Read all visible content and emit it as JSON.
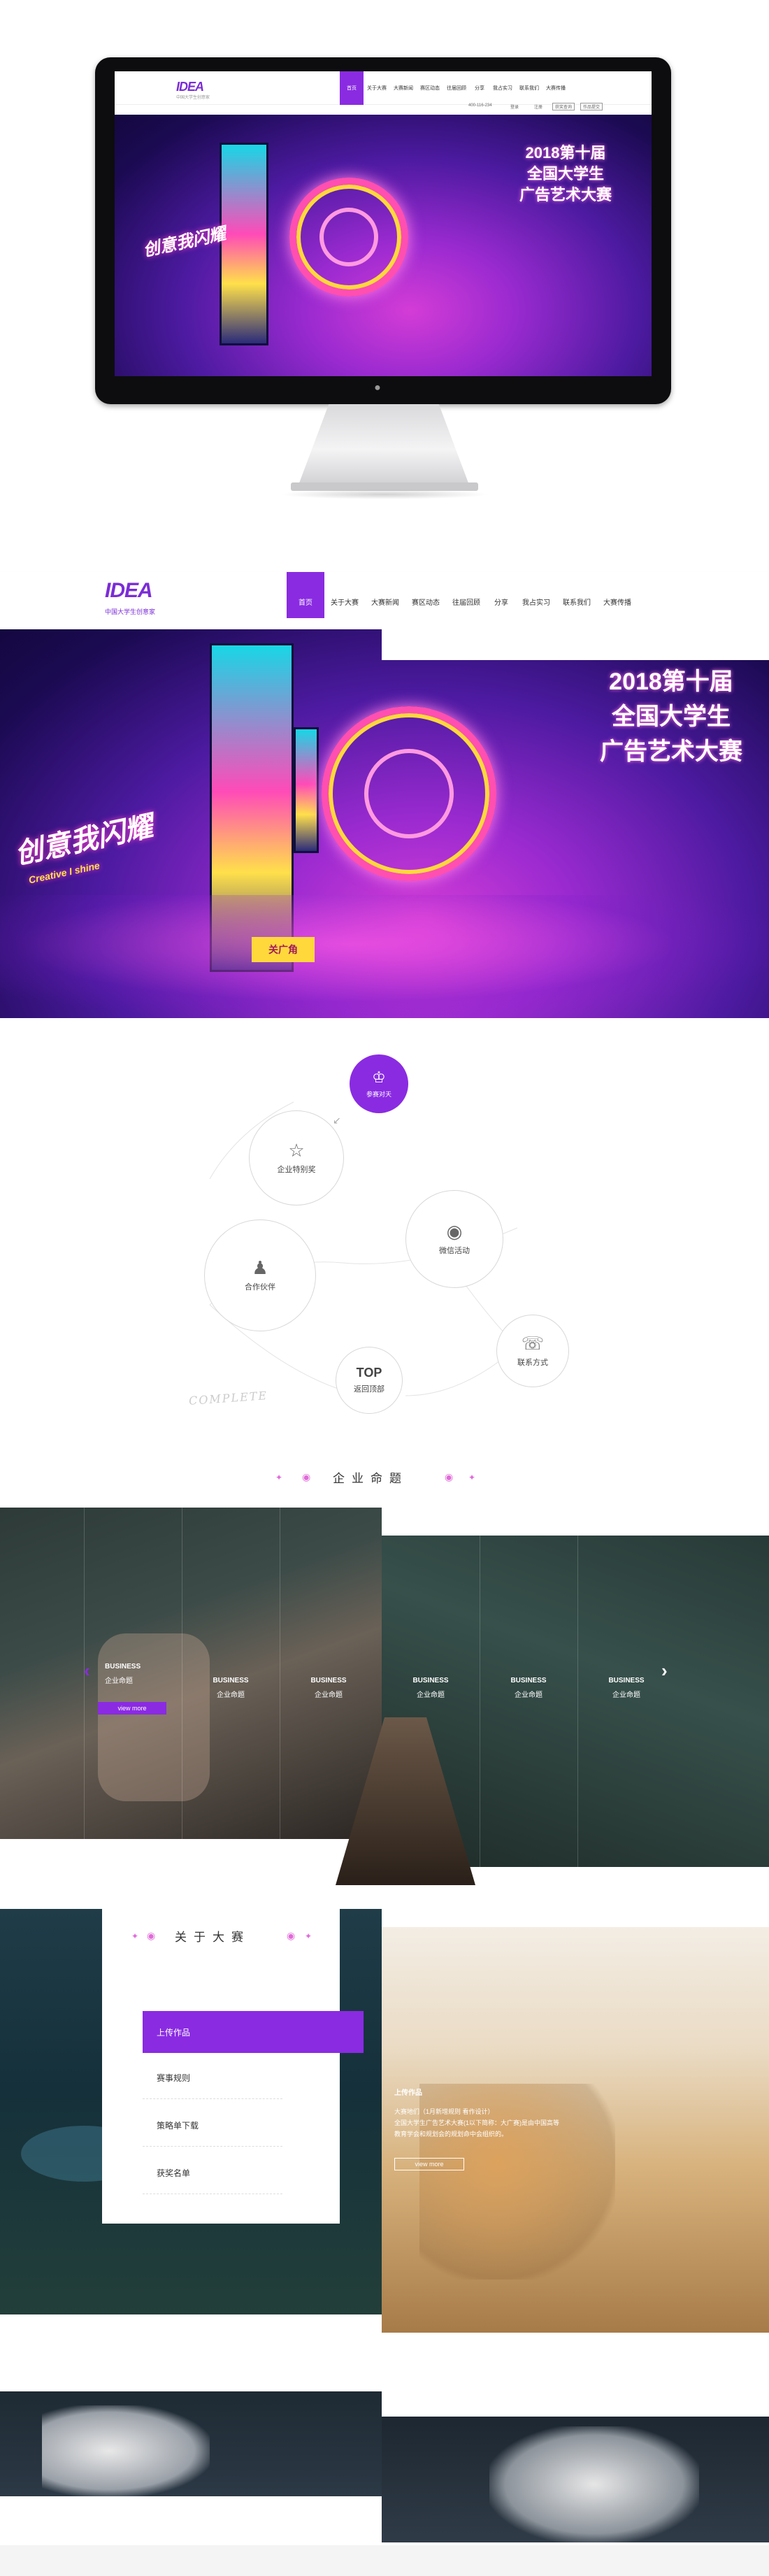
{
  "brand": {
    "logo": "IDEA",
    "tagline": "中国大学生创意家",
    "accent": "#8a2be2"
  },
  "nav": {
    "items": [
      "首页",
      "关于大赛",
      "大赛新闻",
      "赛区动态",
      "往届回顾",
      "分享",
      "我占实习",
      "联系我们",
      "大赛传播"
    ],
    "active_index": 0,
    "phone": "400-116-234",
    "login": "登录",
    "register": "注册",
    "query_btn": "获奖查询",
    "submit_btn": "作品提交"
  },
  "banner": {
    "line1": "2018第十届",
    "line2": "全国大学生",
    "line3": "广告艺术大赛",
    "slogan": "创意我闪耀",
    "slogan_en": "Creative I shine",
    "sign": "关广角"
  },
  "orbit": {
    "center": "参赛对天",
    "items": [
      "企业特别奖",
      "合作伙伴",
      "微信活动",
      "联系方式",
      "返回顶部"
    ],
    "top_label": "TOP",
    "watermark": "COMPLETE"
  },
  "enterprise": {
    "title": "企业命题",
    "columns": [
      {
        "en": "BUSINESS",
        "zh": "企业命题"
      },
      {
        "en": "BUSINESS",
        "zh": "企业命题"
      },
      {
        "en": "BUSINESS",
        "zh": "企业命题"
      },
      {
        "en": "BUSINESS",
        "zh": "企业命题"
      },
      {
        "en": "BUSINESS",
        "zh": "企业命题"
      },
      {
        "en": "BUSINESS",
        "zh": "企业命题"
      }
    ],
    "view_more": "view more"
  },
  "about": {
    "title": "关于大赛",
    "menu": [
      "上传作品",
      "赛事规则",
      "策略单下载",
      "获奖名单"
    ],
    "active_index": 0,
    "panel_title": "上传作品",
    "panel_lines": [
      "大赛地们（1月新增规则 看作设计）",
      "全国大学生广告艺术大赛(1以下简称：大广赛)是由中国高等",
      "教育学会和规划会的规划命中会组织的。"
    ],
    "panel_btn": "view more"
  },
  "colors": {
    "purple": "#8a2be2",
    "dark": "#1b0a52",
    "pink": "#ff4fb0",
    "yellow": "#ffd83c",
    "cyan": "#18d7e6"
  }
}
